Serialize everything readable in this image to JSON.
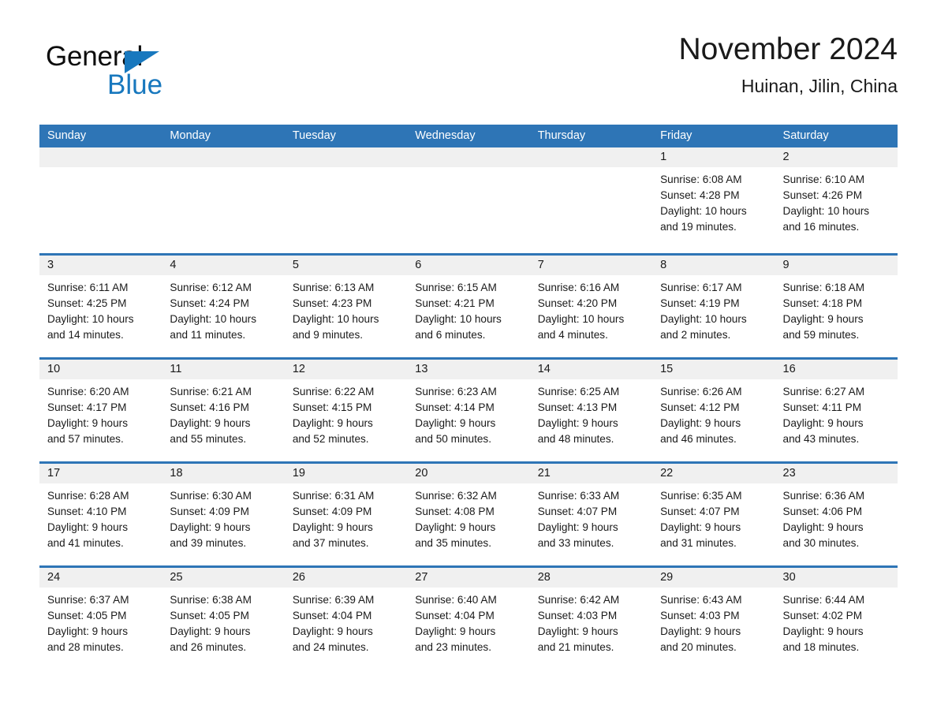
{
  "brand": {
    "name_part1": "General",
    "name_part2": "Blue",
    "triangle_icon": "blue-triangle-icon",
    "accent_color": "#1878be"
  },
  "header": {
    "title": "November 2024",
    "location": "Huinan, Jilin, China"
  },
  "calendar": {
    "header_color": "#2e75b6",
    "day_header_bg": "#f0f0f0",
    "weekday_labels": [
      "Sunday",
      "Monday",
      "Tuesday",
      "Wednesday",
      "Thursday",
      "Friday",
      "Saturday"
    ],
    "weeks": [
      [
        {
          "date": "",
          "lines": []
        },
        {
          "date": "",
          "lines": []
        },
        {
          "date": "",
          "lines": []
        },
        {
          "date": "",
          "lines": []
        },
        {
          "date": "",
          "lines": []
        },
        {
          "date": "1",
          "lines": [
            "Sunrise: 6:08 AM",
            "Sunset: 4:28 PM",
            "Daylight: 10 hours",
            "and 19 minutes."
          ]
        },
        {
          "date": "2",
          "lines": [
            "Sunrise: 6:10 AM",
            "Sunset: 4:26 PM",
            "Daylight: 10 hours",
            "and 16 minutes."
          ]
        }
      ],
      [
        {
          "date": "3",
          "lines": [
            "Sunrise: 6:11 AM",
            "Sunset: 4:25 PM",
            "Daylight: 10 hours",
            "and 14 minutes."
          ]
        },
        {
          "date": "4",
          "lines": [
            "Sunrise: 6:12 AM",
            "Sunset: 4:24 PM",
            "Daylight: 10 hours",
            "and 11 minutes."
          ]
        },
        {
          "date": "5",
          "lines": [
            "Sunrise: 6:13 AM",
            "Sunset: 4:23 PM",
            "Daylight: 10 hours",
            "and 9 minutes."
          ]
        },
        {
          "date": "6",
          "lines": [
            "Sunrise: 6:15 AM",
            "Sunset: 4:21 PM",
            "Daylight: 10 hours",
            "and 6 minutes."
          ]
        },
        {
          "date": "7",
          "lines": [
            "Sunrise: 6:16 AM",
            "Sunset: 4:20 PM",
            "Daylight: 10 hours",
            "and 4 minutes."
          ]
        },
        {
          "date": "8",
          "lines": [
            "Sunrise: 6:17 AM",
            "Sunset: 4:19 PM",
            "Daylight: 10 hours",
            "and 2 minutes."
          ]
        },
        {
          "date": "9",
          "lines": [
            "Sunrise: 6:18 AM",
            "Sunset: 4:18 PM",
            "Daylight: 9 hours",
            "and 59 minutes."
          ]
        }
      ],
      [
        {
          "date": "10",
          "lines": [
            "Sunrise: 6:20 AM",
            "Sunset: 4:17 PM",
            "Daylight: 9 hours",
            "and 57 minutes."
          ]
        },
        {
          "date": "11",
          "lines": [
            "Sunrise: 6:21 AM",
            "Sunset: 4:16 PM",
            "Daylight: 9 hours",
            "and 55 minutes."
          ]
        },
        {
          "date": "12",
          "lines": [
            "Sunrise: 6:22 AM",
            "Sunset: 4:15 PM",
            "Daylight: 9 hours",
            "and 52 minutes."
          ]
        },
        {
          "date": "13",
          "lines": [
            "Sunrise: 6:23 AM",
            "Sunset: 4:14 PM",
            "Daylight: 9 hours",
            "and 50 minutes."
          ]
        },
        {
          "date": "14",
          "lines": [
            "Sunrise: 6:25 AM",
            "Sunset: 4:13 PM",
            "Daylight: 9 hours",
            "and 48 minutes."
          ]
        },
        {
          "date": "15",
          "lines": [
            "Sunrise: 6:26 AM",
            "Sunset: 4:12 PM",
            "Daylight: 9 hours",
            "and 46 minutes."
          ]
        },
        {
          "date": "16",
          "lines": [
            "Sunrise: 6:27 AM",
            "Sunset: 4:11 PM",
            "Daylight: 9 hours",
            "and 43 minutes."
          ]
        }
      ],
      [
        {
          "date": "17",
          "lines": [
            "Sunrise: 6:28 AM",
            "Sunset: 4:10 PM",
            "Daylight: 9 hours",
            "and 41 minutes."
          ]
        },
        {
          "date": "18",
          "lines": [
            "Sunrise: 6:30 AM",
            "Sunset: 4:09 PM",
            "Daylight: 9 hours",
            "and 39 minutes."
          ]
        },
        {
          "date": "19",
          "lines": [
            "Sunrise: 6:31 AM",
            "Sunset: 4:09 PM",
            "Daylight: 9 hours",
            "and 37 minutes."
          ]
        },
        {
          "date": "20",
          "lines": [
            "Sunrise: 6:32 AM",
            "Sunset: 4:08 PM",
            "Daylight: 9 hours",
            "and 35 minutes."
          ]
        },
        {
          "date": "21",
          "lines": [
            "Sunrise: 6:33 AM",
            "Sunset: 4:07 PM",
            "Daylight: 9 hours",
            "and 33 minutes."
          ]
        },
        {
          "date": "22",
          "lines": [
            "Sunrise: 6:35 AM",
            "Sunset: 4:07 PM",
            "Daylight: 9 hours",
            "and 31 minutes."
          ]
        },
        {
          "date": "23",
          "lines": [
            "Sunrise: 6:36 AM",
            "Sunset: 4:06 PM",
            "Daylight: 9 hours",
            "and 30 minutes."
          ]
        }
      ],
      [
        {
          "date": "24",
          "lines": [
            "Sunrise: 6:37 AM",
            "Sunset: 4:05 PM",
            "Daylight: 9 hours",
            "and 28 minutes."
          ]
        },
        {
          "date": "25",
          "lines": [
            "Sunrise: 6:38 AM",
            "Sunset: 4:05 PM",
            "Daylight: 9 hours",
            "and 26 minutes."
          ]
        },
        {
          "date": "26",
          "lines": [
            "Sunrise: 6:39 AM",
            "Sunset: 4:04 PM",
            "Daylight: 9 hours",
            "and 24 minutes."
          ]
        },
        {
          "date": "27",
          "lines": [
            "Sunrise: 6:40 AM",
            "Sunset: 4:04 PM",
            "Daylight: 9 hours",
            "and 23 minutes."
          ]
        },
        {
          "date": "28",
          "lines": [
            "Sunrise: 6:42 AM",
            "Sunset: 4:03 PM",
            "Daylight: 9 hours",
            "and 21 minutes."
          ]
        },
        {
          "date": "29",
          "lines": [
            "Sunrise: 6:43 AM",
            "Sunset: 4:03 PM",
            "Daylight: 9 hours",
            "and 20 minutes."
          ]
        },
        {
          "date": "30",
          "lines": [
            "Sunrise: 6:44 AM",
            "Sunset: 4:02 PM",
            "Daylight: 9 hours",
            "and 18 minutes."
          ]
        }
      ]
    ]
  }
}
